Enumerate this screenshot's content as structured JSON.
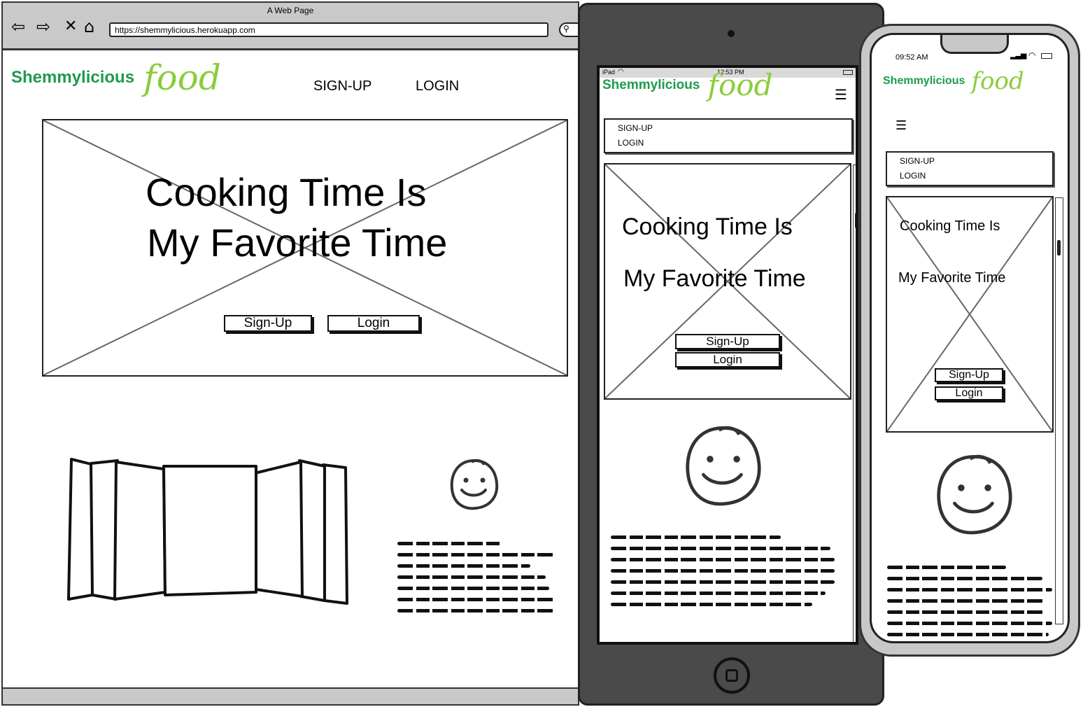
{
  "browser": {
    "window_title": "A Web Page",
    "url": "https://shemmylicious.herokuapp.com",
    "nav_icons": [
      "back-arrow-icon",
      "forward-arrow-icon",
      "close-icon",
      "home-icon",
      "search-icon"
    ]
  },
  "brand": {
    "name": "Shemmylicious",
    "food": "food",
    "name_color": "#1f9a4e",
    "food_color": "#8ccc3c"
  },
  "nav": {
    "signup": "SIGN-UP",
    "login": "LOGIN"
  },
  "hero": {
    "line1": "Cooking Time Is",
    "line2": "My Favorite Time",
    "signup_button": "Sign-Up",
    "login_button": "Login"
  },
  "tablet": {
    "status_device": "iPad",
    "status_time": "12:53 PM"
  },
  "phone": {
    "status_time": "09:52 AM"
  },
  "icons": {
    "menu": "hamburger-icon",
    "avatar": "smiley-icon",
    "gallery": "cover-flow-gallery-icon"
  }
}
